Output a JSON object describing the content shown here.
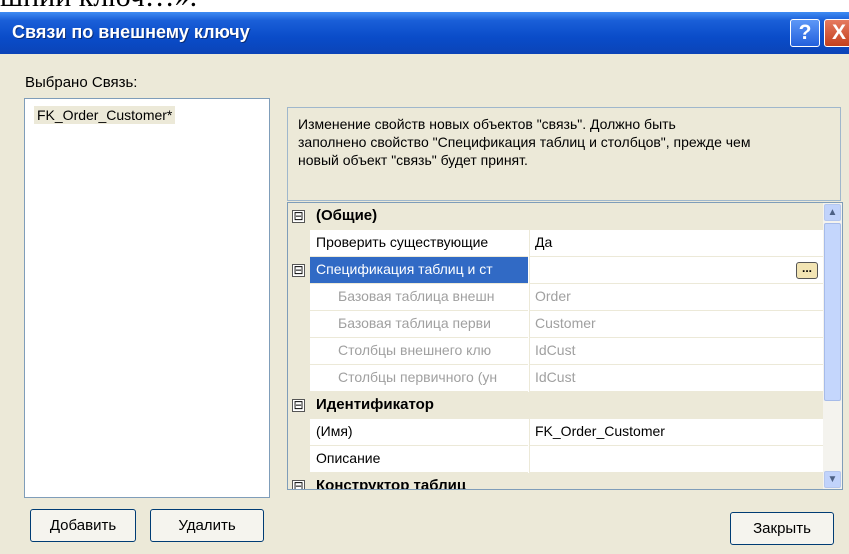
{
  "top_strip_text": "шний ключ…».",
  "window": {
    "title": "Связи по внешнему ключу",
    "help_glyph": "?",
    "close_glyph": "X"
  },
  "left": {
    "label": "Выбрано Связь:",
    "items": [
      "FK_Order_Customer*"
    ],
    "add_button": "Добавить",
    "delete_button": "Удалить"
  },
  "info": {
    "line1": "Изменение свойств новых объектов \"связь\".  Должно быть",
    "line2": "заполнено свойство \"Спецификация таблиц и столбцов\", прежде чем",
    "line3": "новый объект \"связь\" будет принят."
  },
  "grid": {
    "cat_general": "(Общие)",
    "check_existing_name": "Проверить существующие",
    "check_existing_value": "Да",
    "table_spec_name": "Спецификация таблиц и ст",
    "ellipsis_glyph": "...",
    "fk_base_table_name": "Базовая таблица внешн",
    "fk_base_table_value": "Order",
    "pk_base_table_name": "Базовая таблица перви",
    "pk_base_table_value": "Customer",
    "fk_columns_name": "Столбцы внешнего клю",
    "fk_columns_value": "IdCust",
    "pk_columns_name": "Столбцы первичного (ун",
    "pk_columns_value": "IdCust",
    "cat_identity": "Идентификатор",
    "name_name": "(Имя)",
    "name_value": "FK_Order_Customer",
    "description_name": "Описание",
    "description_value": "",
    "cat_designer": "Конструктор таблиц",
    "expand_glyph": "⊟"
  },
  "scrollbar": {
    "up_glyph": "▲",
    "down_glyph": "▼"
  },
  "close_button": "Закрыть",
  "colors": {
    "titlebar": "#0a4cc9",
    "dialog_bg": "#ece9d8",
    "selection": "#316ac5"
  }
}
